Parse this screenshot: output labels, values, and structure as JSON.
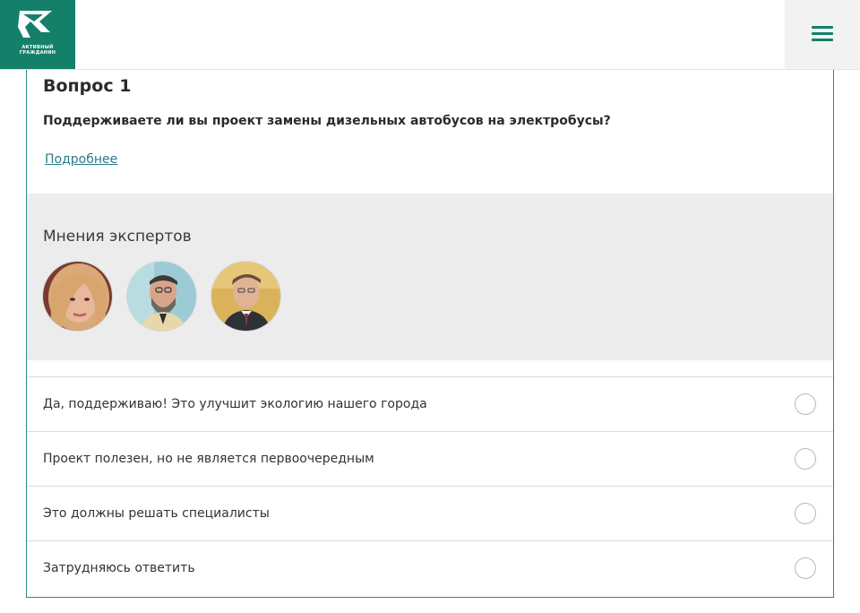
{
  "header": {
    "logo_line1": "АКТИВНЫЙ",
    "logo_line2": "ГРАЖДАНИН",
    "menu_icon": "hamburger-menu-icon",
    "brand_color": "#14806a"
  },
  "question": {
    "title": "Вопрос 1",
    "text": "Поддерживаете ли вы проект замены дизельных автобусов на электробусы?",
    "more_link": "Подробнее"
  },
  "experts": {
    "title": "Мнения экспертов",
    "avatars": [
      "expert-1-photo",
      "expert-2-photo",
      "expert-3-photo"
    ]
  },
  "options": [
    "Да, поддерживаю! Это улучшит экологию нашего города",
    "Проект полезен, но не является первоочередным",
    "Это должны решать специалисты",
    "Затрудняюсь ответить"
  ]
}
